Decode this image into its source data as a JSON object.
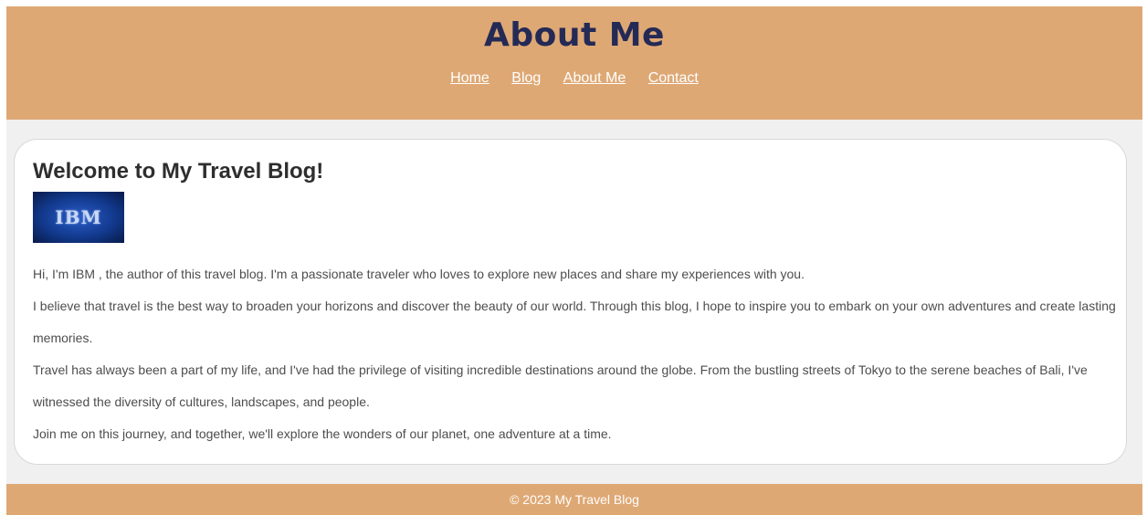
{
  "header": {
    "title": "About Me",
    "nav": [
      "Home",
      "Blog",
      "About Me",
      "Contact"
    ]
  },
  "main": {
    "heading": "Welcome to My Travel Blog!",
    "logo_text": "IBM",
    "paragraphs": [
      "Hi, I'm IBM , the author of this travel blog. I'm a passionate traveler who loves to explore new places and share my experiences with you.",
      "I believe that travel is the best way to broaden your horizons and discover the beauty of our world. Through this blog, I hope to inspire you to embark on your own adventures and create lasting memories.",
      "Travel has always been a part of my life, and I've had the privilege of visiting incredible destinations around the globe. From the bustling streets of Tokyo to the serene beaches of Bali, I've witnessed the diversity of cultures, landscapes, and people.",
      "Join me on this journey, and together, we'll explore the wonders of our planet, one adventure at a time."
    ]
  },
  "footer": {
    "text": "© 2023 My Travel Blog"
  },
  "colors": {
    "header_bg": "#dea874",
    "title": "#242a56",
    "page_bg": "#f0f0f0",
    "card_bg": "#ffffff",
    "body_text": "#4d4d4d"
  }
}
